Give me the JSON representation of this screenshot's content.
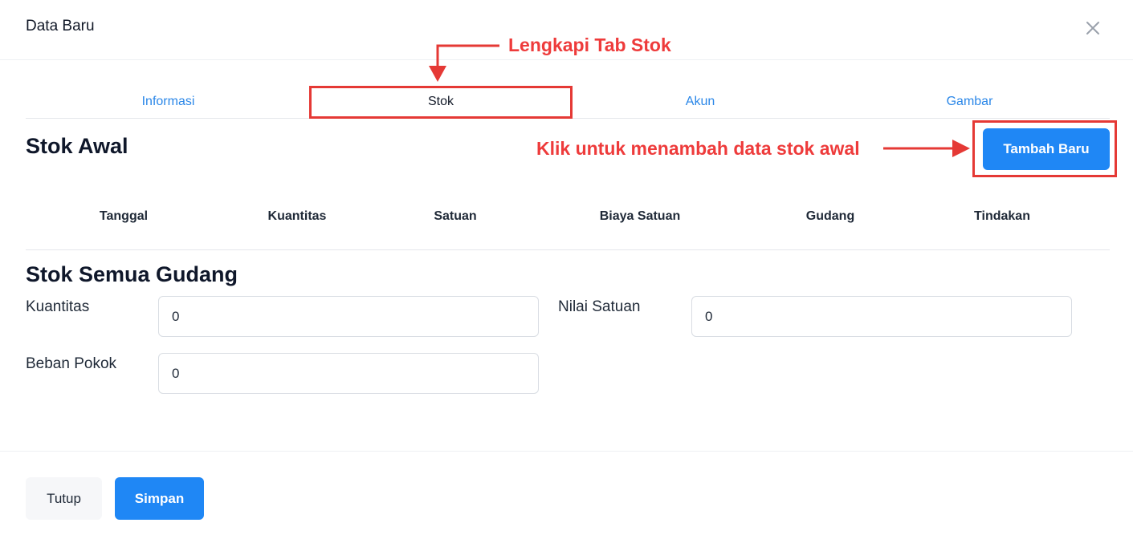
{
  "modal": {
    "title": "Data Baru"
  },
  "tabs": [
    {
      "label": "Informasi",
      "active": false
    },
    {
      "label": "Stok",
      "active": true
    },
    {
      "label": "Akun",
      "active": false
    },
    {
      "label": "Gambar",
      "active": false
    }
  ],
  "stok_awal": {
    "title": "Stok Awal",
    "add_button": "Tambah Baru",
    "columns": [
      "Tanggal",
      "Kuantitas",
      "Satuan",
      "Biaya Satuan",
      "Gudang",
      "Tindakan"
    ]
  },
  "stok_semua_gudang": {
    "title": "Stok Semua Gudang",
    "fields": {
      "kuantitas": {
        "label": "Kuantitas",
        "value": "0"
      },
      "nilai_satuan": {
        "label": "Nilai Satuan",
        "value": "0"
      },
      "beban_pokok": {
        "label": "Beban Pokok",
        "value": "0"
      }
    }
  },
  "footer": {
    "close_label": "Tutup",
    "save_label": "Simpan"
  },
  "annotations": {
    "tab_hint": "Lengkapi Tab Stok",
    "button_hint": "Klik untuk menambah data stok awal",
    "color": "#ee3b3b"
  },
  "colors": {
    "primary": "#1f87f5",
    "link": "#2b87e8"
  },
  "icons": {
    "close": "close-icon"
  }
}
